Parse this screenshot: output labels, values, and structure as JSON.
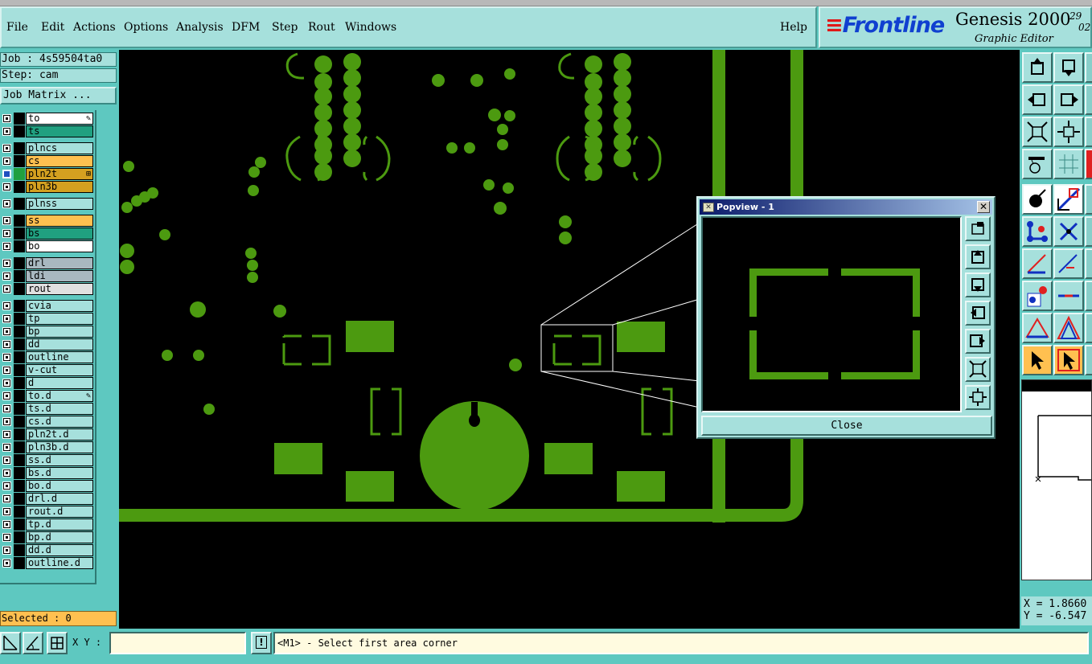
{
  "menubar": {
    "items": [
      "File",
      "Edit",
      "Actions",
      "Options",
      "Analysis",
      "DFM",
      "Step",
      "Rout",
      "Windows"
    ],
    "help": "Help"
  },
  "brand": {
    "logo": "Frontline",
    "title": "Genesis 2000",
    "subtitle": "Graphic Editor",
    "date_top": "29",
    "date_bottom": "02"
  },
  "job": {
    "job_label": "Job : 4s59504ta0",
    "step_label": "Step: cam",
    "matrix_button": "Job Matrix ..."
  },
  "layers": [
    {
      "name": "to",
      "color": "#ffffff",
      "mark": "✎",
      "checked": false
    },
    {
      "name": "ts",
      "color": "#20a080",
      "mark": "",
      "checked": false
    },
    {
      "name": "plncs",
      "color": "#a6e0dc",
      "mark": "",
      "checked": false
    },
    {
      "name": "cs",
      "color": "#ffc050",
      "mark": "",
      "checked": false
    },
    {
      "name": "pln2t",
      "color": "#d4a020",
      "mark": "⊞",
      "checked": true
    },
    {
      "name": "pln3b",
      "color": "#d4a020",
      "mark": "",
      "checked": false
    },
    {
      "name": "plnss",
      "color": "#a6e0dc",
      "mark": "",
      "checked": false
    },
    {
      "name": "ss",
      "color": "#ffc050",
      "mark": "",
      "checked": false
    },
    {
      "name": "bs",
      "color": "#20a080",
      "mark": "",
      "checked": false
    },
    {
      "name": "bo",
      "color": "#ffffff",
      "mark": "",
      "checked": false
    },
    {
      "name": "drl",
      "color": "#a8b8c0",
      "mark": "",
      "checked": false
    },
    {
      "name": "ldi",
      "color": "#a8b8c0",
      "mark": "",
      "checked": false
    },
    {
      "name": "rout",
      "color": "#e0e0e0",
      "mark": "",
      "checked": false
    },
    {
      "name": "cvia",
      "color": "#a6e0dc",
      "mark": "",
      "checked": false
    },
    {
      "name": "tp",
      "color": "#a6e0dc",
      "mark": "",
      "checked": false
    },
    {
      "name": "bp",
      "color": "#a6e0dc",
      "mark": "",
      "checked": false
    },
    {
      "name": "dd",
      "color": "#a6e0dc",
      "mark": "",
      "checked": false
    },
    {
      "name": "outline",
      "color": "#a6e0dc",
      "mark": "",
      "checked": false
    },
    {
      "name": "v-cut",
      "color": "#a6e0dc",
      "mark": "",
      "checked": false
    },
    {
      "name": "d",
      "color": "#a6e0dc",
      "mark": "",
      "checked": false
    },
    {
      "name": "to.d",
      "color": "#a6e0dc",
      "mark": "✎",
      "checked": false
    },
    {
      "name": "ts.d",
      "color": "#a6e0dc",
      "mark": "",
      "checked": false
    },
    {
      "name": "cs.d",
      "color": "#a6e0dc",
      "mark": "",
      "checked": false
    },
    {
      "name": "pln2t.d",
      "color": "#a6e0dc",
      "mark": "",
      "checked": false
    },
    {
      "name": "pln3b.d",
      "color": "#a6e0dc",
      "mark": "",
      "checked": false
    },
    {
      "name": "ss.d",
      "color": "#a6e0dc",
      "mark": "",
      "checked": false
    },
    {
      "name": "bs.d",
      "color": "#a6e0dc",
      "mark": "",
      "checked": false
    },
    {
      "name": "bo.d",
      "color": "#a6e0dc",
      "mark": "",
      "checked": false
    },
    {
      "name": "drl.d",
      "color": "#a6e0dc",
      "mark": "",
      "checked": false
    },
    {
      "name": "rout.d",
      "color": "#a6e0dc",
      "mark": "",
      "checked": false
    },
    {
      "name": "tp.d",
      "color": "#a6e0dc",
      "mark": "",
      "checked": false
    },
    {
      "name": "bp.d",
      "color": "#a6e0dc",
      "mark": "",
      "checked": false
    },
    {
      "name": "dd.d",
      "color": "#a6e0dc",
      "mark": "",
      "checked": false
    },
    {
      "name": "outline.d",
      "color": "#a6e0dc",
      "mark": "",
      "checked": false
    }
  ],
  "selected": "Selected : 0",
  "popview": {
    "title": "Popview - 1",
    "close_label": "Close"
  },
  "coords": {
    "x": "X = 1.8660",
    "y": "Y = -6.547"
  },
  "status": {
    "xy_label": "X Y :",
    "xy_value": "",
    "warn_glyph": "!",
    "prompt": "<M1> - Select first area corner"
  },
  "colors": {
    "pcb_copper": "#4c9a10",
    "panel": "#5ec8c0",
    "button": "#a6e0dc",
    "highlight": "#ffc050"
  }
}
